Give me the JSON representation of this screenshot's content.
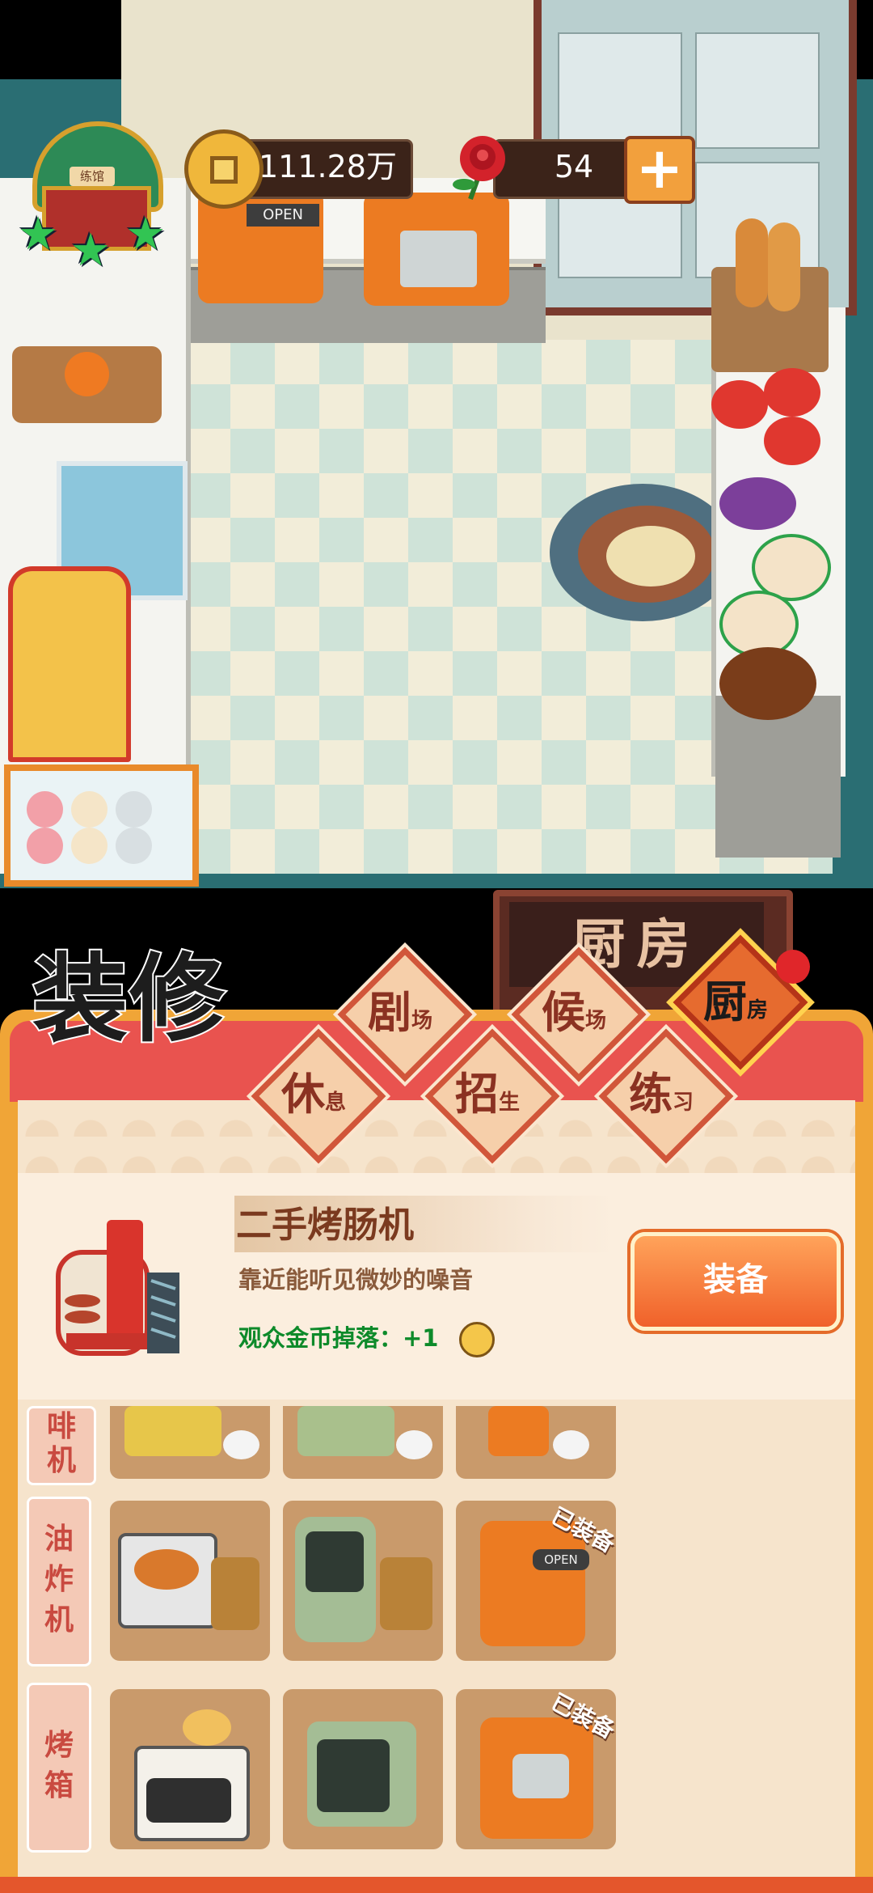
{
  "hud": {
    "restaurant_plate": "练馆",
    "coins": "111.28万",
    "roses": "54",
    "add_label": "+"
  },
  "scene": {
    "fryer_sign": "OPEN",
    "room_sign": "厨房"
  },
  "panel": {
    "title": "装修",
    "tabs": [
      {
        "big": "剧",
        "small": "场",
        "active": false
      },
      {
        "big": "候",
        "small": "场",
        "active": false
      },
      {
        "big": "厨",
        "small": "房",
        "active": true
      },
      {
        "big": "休",
        "small": "息",
        "active": false
      },
      {
        "big": "招",
        "small": "生",
        "active": false
      },
      {
        "big": "练",
        "small": "习",
        "active": false
      }
    ],
    "item": {
      "name": "二手烤肠机",
      "description": "靠近能听见微妙的噪音",
      "bonus_label": "观众金币掉落：+1",
      "equip_button": "装备"
    },
    "rows": [
      {
        "label": "啡机",
        "equipped_index": null
      },
      {
        "label": "油炸机",
        "equipped_index": 2
      },
      {
        "label": "烤箱",
        "equipped_index": 2
      }
    ],
    "equipped_text": "已装备",
    "fryer_item_sign": "OPEN"
  }
}
